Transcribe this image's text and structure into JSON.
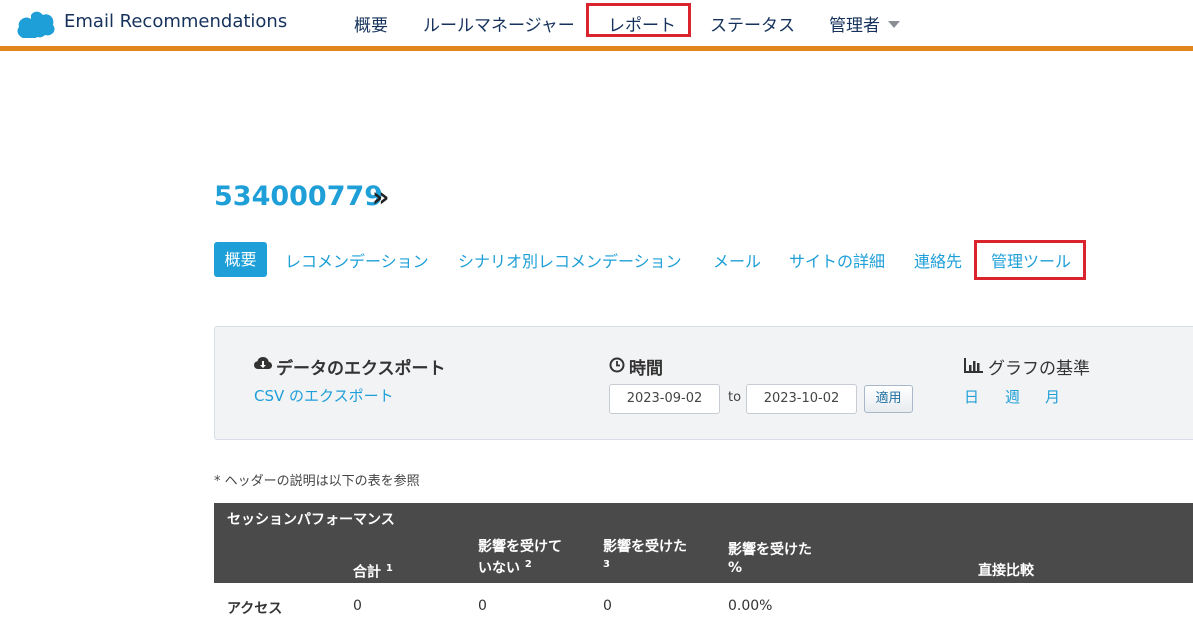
{
  "app": {
    "title": "Email Recommendations",
    "logo_icon": "salesforce-cloud-icon",
    "brand_color": "#1e9fd8",
    "accent_bar_color": "#e0861c"
  },
  "nav": {
    "items": [
      {
        "label": "概要"
      },
      {
        "label": "ルールマネージャー"
      },
      {
        "label": "レポート"
      },
      {
        "label": "ステータス"
      },
      {
        "label": "管理者"
      }
    ]
  },
  "account": {
    "id": "534000779",
    "separator": "»"
  },
  "subtabs": {
    "items": [
      {
        "label": "概要"
      },
      {
        "label": "レコメンデーション"
      },
      {
        "label": "シナリオ別レコメンデーション"
      },
      {
        "label": "メール"
      },
      {
        "label": "サイトの詳細"
      },
      {
        "label": "連絡先"
      },
      {
        "label": "管理ツール"
      }
    ]
  },
  "export": {
    "heading": "データのエクスポート",
    "icon": "cloud-download-icon",
    "link": "CSV のエクスポート"
  },
  "time": {
    "heading": "時間",
    "icon": "clock-icon",
    "from": "2023-09-02",
    "to_label": "to",
    "to": "2023-10-02",
    "apply": "適用"
  },
  "graph": {
    "heading": "グラフの基準",
    "icon": "bar-chart-icon",
    "options": [
      "日",
      "週",
      "月"
    ]
  },
  "note": "* ヘッダーの説明は以下の表を参照",
  "table": {
    "title": "セッションパフォーマンス",
    "columns": [
      {
        "label": "合計",
        "sup": "1"
      },
      {
        "label": "影響を受けて いない",
        "sup": "2"
      },
      {
        "label": "影響を受けた",
        "sup": "3"
      },
      {
        "label": "影響を受けた %",
        "sup": ""
      },
      {
        "label": "直接比較",
        "sup": ""
      }
    ],
    "rows": [
      {
        "label": "アクセス",
        "values": [
          "0",
          "0",
          "0",
          "0.00%"
        ]
      }
    ]
  }
}
